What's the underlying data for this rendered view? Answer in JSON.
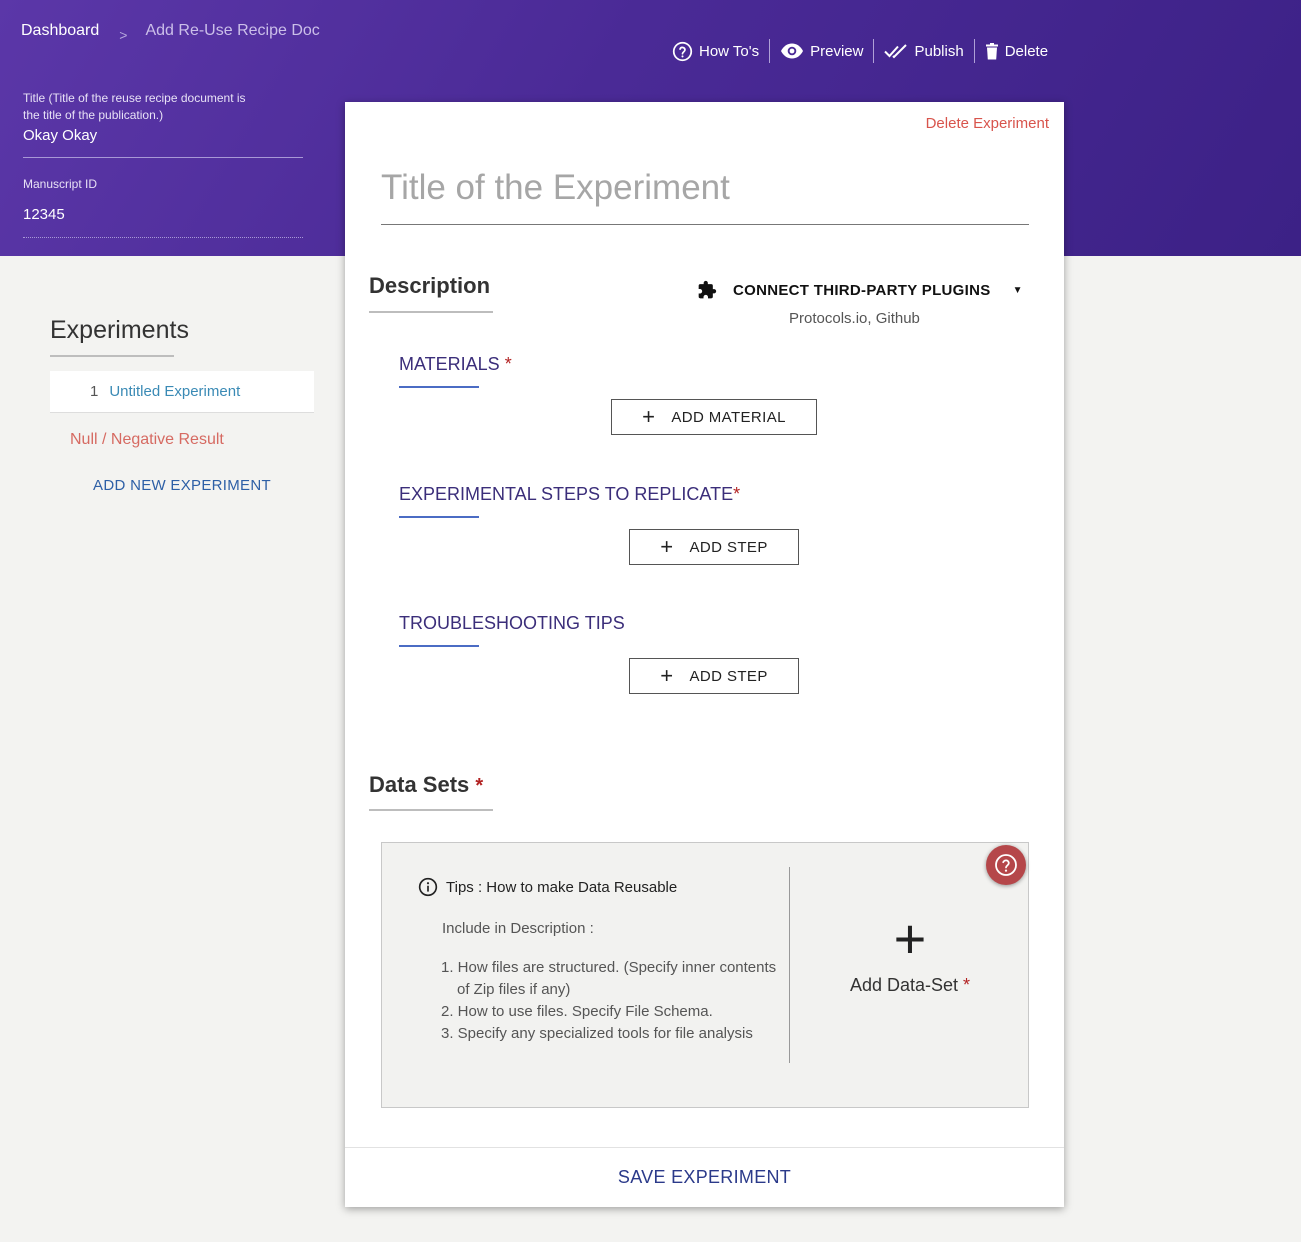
{
  "breadcrumb": {
    "home": "Dashboard",
    "separator": ">",
    "current": "Add Re-Use Recipe Doc"
  },
  "toolbar": {
    "howtos": "How To's",
    "preview": "Preview",
    "publish": "Publish",
    "delete": "Delete"
  },
  "document": {
    "title_label_line1": "Title (Title of the reuse recipe document is",
    "title_label_line2": "the title of the publication.)",
    "title_value": "Okay Okay",
    "manuscript_label": "Manuscript ID",
    "manuscript_value": "12345"
  },
  "sidebar": {
    "heading": "Experiments",
    "items": [
      {
        "number": "1",
        "name": "Untitled Experiment"
      }
    ],
    "null_result": "Null / Negative Result",
    "add_new": "ADD NEW EXPERIMENT"
  },
  "experiment": {
    "delete": "Delete Experiment",
    "title_placeholder": "Title of the Experiment",
    "description_heading": "Description",
    "plugins_label": "CONNECT THIRD-PARTY PLUGINS",
    "plugins_sub": "Protocols.io, Github",
    "materials": {
      "title": "MATERIALS",
      "required": "*",
      "button": "ADD MATERIAL",
      "button_icon": "+"
    },
    "steps": {
      "title": "EXPERIMENTAL STEPS TO REPLICATE",
      "required": "*",
      "button": "ADD STEP",
      "button_icon": "+"
    },
    "troubleshooting": {
      "title": "TROUBLESHOOTING TIPS",
      "button": "ADD STEP",
      "button_icon": "+"
    },
    "datasets_heading": "Data Sets",
    "datasets_required": "*",
    "tips": {
      "heading": "Tips : How to make Data Reusable",
      "include": "Include in Description :",
      "items": [
        "1. How files are structured. (Specify inner contents of Zip files if any)",
        "2. How to use files. Specify File Schema.",
        "3. Specify any specialized tools for file analysis"
      ]
    },
    "add_dataset": "Add Data-Set",
    "add_dataset_required": "*",
    "add_dataset_icon": "+",
    "save": "SAVE EXPERIMENT"
  },
  "icons": {
    "howtos": "question-circle-icon",
    "preview": "eye-icon",
    "publish": "double-check-icon",
    "delete": "trash-icon",
    "plugins": "puzzle-icon",
    "tips": "info-circle-icon",
    "help": "question-circle-icon"
  },
  "colors": {
    "header_gradient_start": "#5b37a8",
    "header_gradient_end": "#3c2186",
    "danger": "#d8544c",
    "link": "#3a8ab5",
    "section_title": "#3b2e7a",
    "help_button": "#b5474a"
  }
}
